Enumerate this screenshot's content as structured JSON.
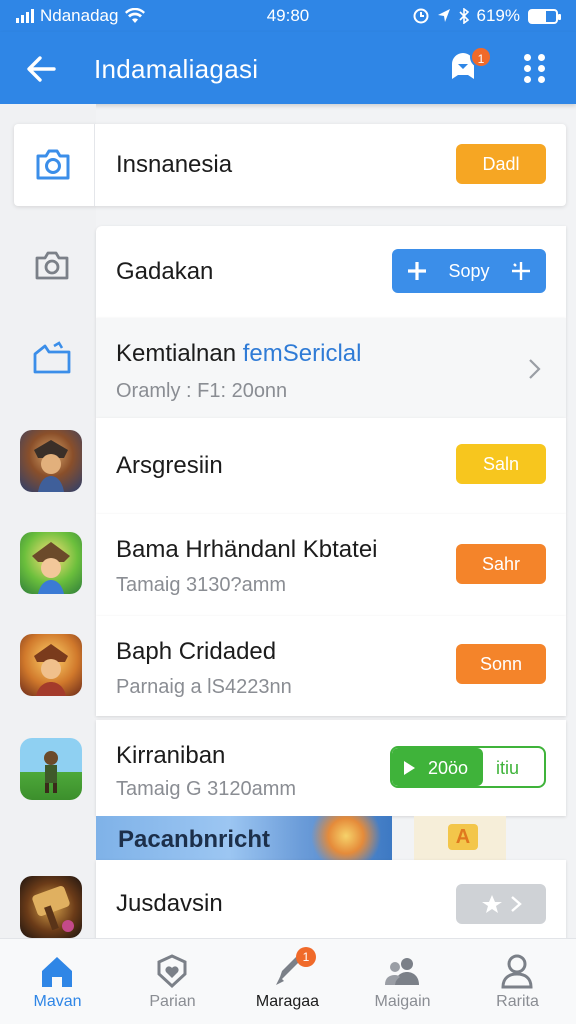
{
  "status_bar": {
    "carrier": "Ndanadag",
    "time": "49:80",
    "battery": "619%",
    "battery_level": 0.62
  },
  "app_bar": {
    "title": "Indamaliagasi",
    "notification_count": "1",
    "back_icon": "back-arrow-icon",
    "bell_icon": "notification-bell-icon",
    "more_icon": "more-grid-icon"
  },
  "top_item": {
    "label": "Insnanesia",
    "button": "Dadl",
    "icon": "camera-icon"
  },
  "rows": [
    {
      "title": "Gadakan",
      "subtitle": "",
      "button": "Sopy",
      "button_style": "blue",
      "icon": "camera-icon"
    },
    {
      "title": "Kemtialnan",
      "title_accent": "femSericlal",
      "subtitle": "Oramly : F1: 20onn",
      "button": "",
      "button_style": "chevron",
      "icon": "folder-tag-icon"
    },
    {
      "title": "Arsgresiin",
      "subtitle": "",
      "button": "Saln",
      "button_style": "yellow",
      "icon": "game-icon-warrior"
    },
    {
      "title": "Bama Hrhändanl Kbtatei",
      "subtitle": "Tamaig 3130?amm",
      "button": "Sahr",
      "button_style": "deep",
      "icon": "game-icon-elf"
    },
    {
      "title": "Baph Cridaded",
      "subtitle": "Parnaig a lS4223nn",
      "button": "Sonn",
      "button_style": "deep",
      "icon": "game-icon-knight"
    },
    {
      "title": "Kirraniban",
      "subtitle": "Tamaig G 3120amm",
      "button": "20öo",
      "button_style": "progress",
      "progress_text": "itiu",
      "progress": 0.6,
      "icon": "game-icon-soldier"
    },
    {
      "title": "Jusdavsin",
      "subtitle": "",
      "button": "",
      "button_style": "grey",
      "icon": "game-icon-hammer"
    }
  ],
  "banner": {
    "text": "Pacanbnricht",
    "side_label": "A"
  },
  "bottom_nav": [
    {
      "label": "Mavan",
      "icon": "home-icon",
      "state": "active"
    },
    {
      "label": "Parian",
      "icon": "shield-heart-icon",
      "state": ""
    },
    {
      "label": "Maragaa",
      "icon": "rocket-icon",
      "state": "current",
      "badge": "1"
    },
    {
      "label": "Maigain",
      "icon": "people-icon",
      "state": ""
    },
    {
      "label": "Rarita",
      "icon": "person-icon",
      "state": ""
    }
  ],
  "colors": {
    "primary": "#2f86e6",
    "orange": "#f6a623",
    "yellow": "#f7c61e",
    "deep_orange": "#f4842a",
    "green": "#3fb33a"
  }
}
